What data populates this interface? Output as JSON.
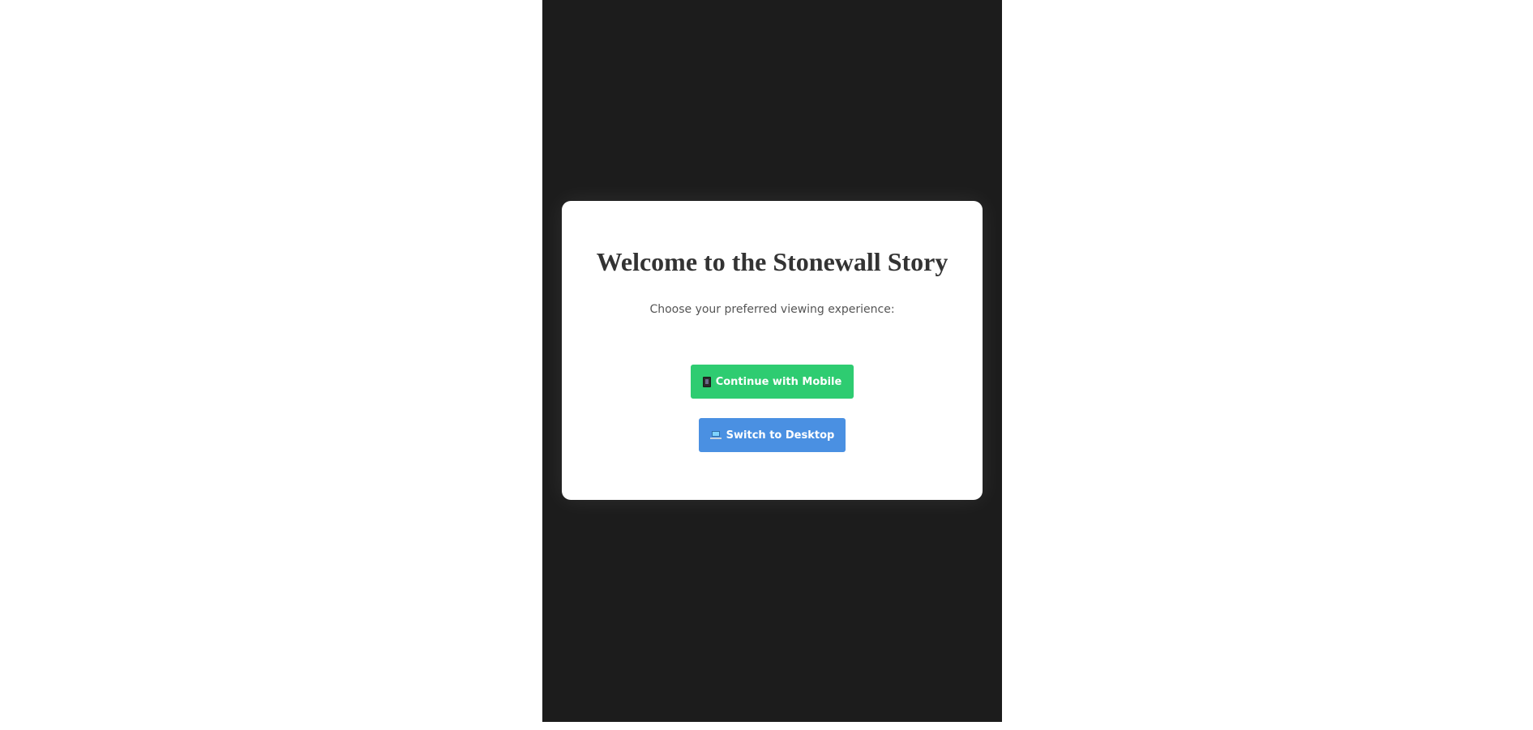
{
  "modal": {
    "title": "Welcome to the Stonewall Story",
    "subtitle": "Choose your preferred viewing experience:"
  },
  "buttons": {
    "mobile": {
      "label": "Continue with Mobile",
      "icon": "mobile-phone-icon",
      "color": "#2ecc71"
    },
    "desktop": {
      "label": "Switch to Desktop",
      "icon": "laptop-icon",
      "color": "#4a90e2"
    }
  },
  "colors": {
    "frame_background": "#1c1c1c",
    "page_background": "#ffffff",
    "modal_background": "#ffffff",
    "title_text": "#333333",
    "subtitle_text": "#555555"
  }
}
